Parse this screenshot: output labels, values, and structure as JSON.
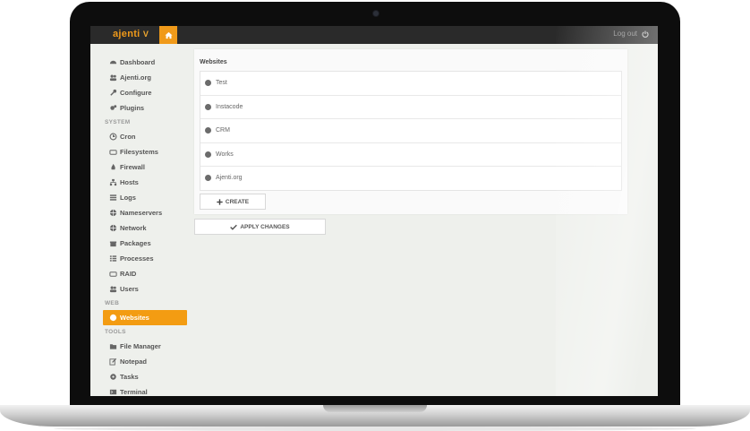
{
  "app": {
    "logo_text": "ajenti",
    "logo_version": "V",
    "logout_label": "Log out"
  },
  "sidebar": {
    "top_items": [
      {
        "label": "Dashboard",
        "icon": "dashboard-icon"
      },
      {
        "label": "Ajenti.org",
        "icon": "users-icon"
      },
      {
        "label": "Configure",
        "icon": "wrench-icon"
      },
      {
        "label": "Plugins",
        "icon": "cogs-icon"
      }
    ],
    "system_title": "SYSTEM",
    "system_items": [
      {
        "label": "Cron",
        "icon": "clock-icon"
      },
      {
        "label": "Filesystems",
        "icon": "hdd-icon"
      },
      {
        "label": "Firewall",
        "icon": "fire-icon"
      },
      {
        "label": "Hosts",
        "icon": "sitemap-icon"
      },
      {
        "label": "Logs",
        "icon": "list-icon"
      },
      {
        "label": "Nameservers",
        "icon": "globe-icon"
      },
      {
        "label": "Network",
        "icon": "globe-icon"
      },
      {
        "label": "Packages",
        "icon": "gift-icon"
      },
      {
        "label": "Processes",
        "icon": "th-list-icon"
      },
      {
        "label": "RAID",
        "icon": "hdd-icon"
      },
      {
        "label": "Users",
        "icon": "users-icon"
      }
    ],
    "web_title": "WEB",
    "web_items": [
      {
        "label": "Websites",
        "icon": "globe-icon",
        "active": true
      }
    ],
    "tools_title": "TOOLS",
    "tools_items": [
      {
        "label": "File Manager",
        "icon": "folder-icon"
      },
      {
        "label": "Notepad",
        "icon": "edit-icon"
      },
      {
        "label": "Tasks",
        "icon": "cog-icon"
      },
      {
        "label": "Terminal",
        "icon": "terminal-icon"
      }
    ]
  },
  "main": {
    "title": "Websites",
    "websites": [
      "Test",
      "Instacode",
      "CRM",
      "Works",
      "Ajenti.org"
    ],
    "create_label": "CREATE",
    "apply_label": "APPLY CHANGES"
  },
  "colors": {
    "accent": "#f39c12",
    "topbar": "#2a2a2a",
    "background": "#eef0ec"
  }
}
